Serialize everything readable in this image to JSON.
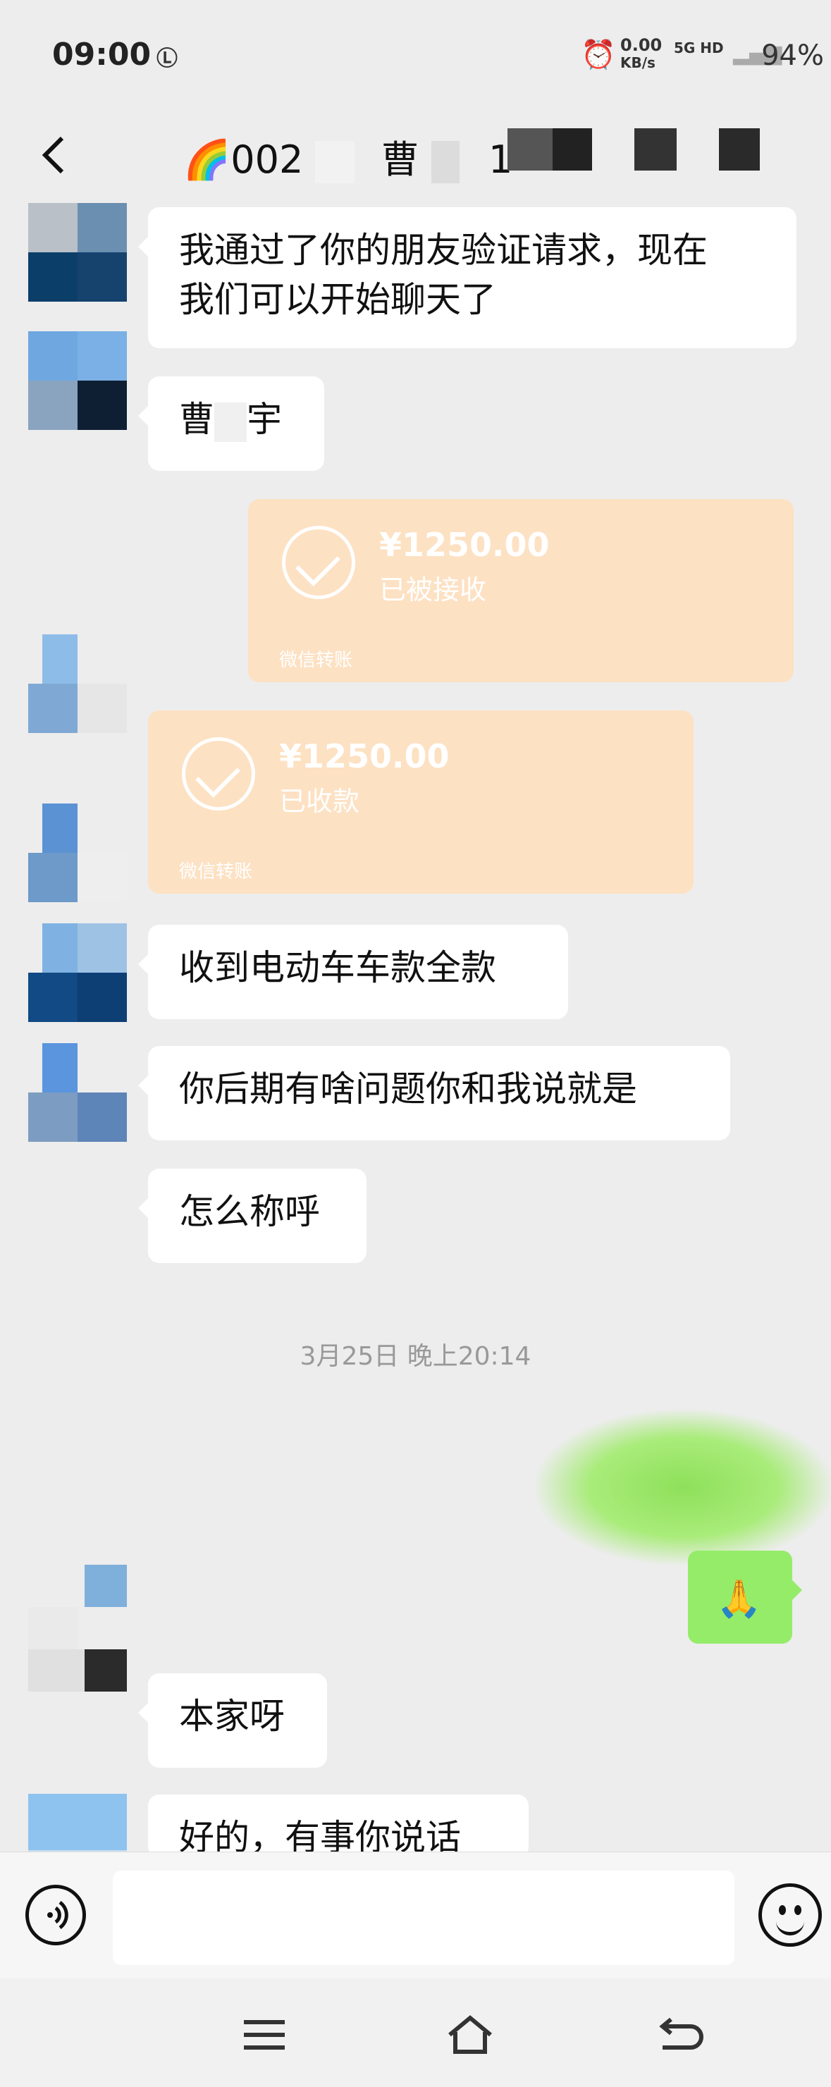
{
  "status_bar": {
    "time": "09:00",
    "network_speed": "0.00",
    "network_unit": "KB/s",
    "network_type": "5G HD",
    "battery": "94%"
  },
  "header": {
    "title_prefix": "🌈002",
    "title_visible": "曹",
    "title_tail": "1"
  },
  "messages": {
    "m1": "我通过了你的朋友验证请求，现在",
    "m1b": "我们可以开始聊天了",
    "m2a": "曹",
    "m2b": "宇",
    "m5": "收到电动车车款全款",
    "m6": "你后期有啥问题你和我说就是",
    "m7": "怎么称呼",
    "m8": "本家呀",
    "m9": "好的，有事你说话"
  },
  "transfers": {
    "t1": {
      "amount": "¥1250.00",
      "status": "已被接收",
      "footer": "微信转账"
    },
    "t2": {
      "amount": "¥1250.00",
      "status": "已收款",
      "footer": "微信转账"
    }
  },
  "timestamp": "3月25日 晚上20:14",
  "colors": {
    "background": "#ededed",
    "transfer": "#fde1c3",
    "self_bubble": "#95ec69"
  },
  "icons": [
    "back-arrow-icon",
    "voice-icon",
    "emoji-icon",
    "menu-icon",
    "home-icon",
    "back-icon",
    "alarm-icon",
    "signal-icon"
  ]
}
